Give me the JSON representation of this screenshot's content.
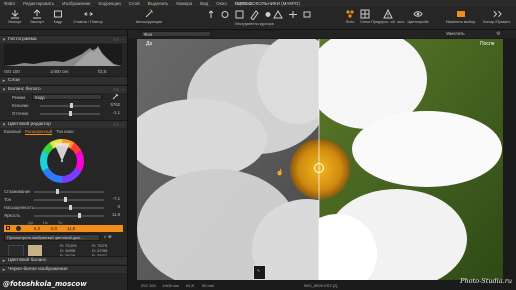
{
  "app": {
    "window_title": "ПИРС СОКОЛЬНИКИ (МАКРО)",
    "menu": [
      "Файл",
      "Редактировать",
      "Изображение",
      "Коррекция",
      "Слой",
      "Выделить",
      "Камера",
      "Вид",
      "Окно",
      "Справка"
    ]
  },
  "toolbar": {
    "left": [
      "Импорт",
      "Экспорт",
      "Кадр",
      "Отмена / Повтор"
    ],
    "auto_adjust": "Автокоррекция",
    "cursor_tools": "Инструменты курсора",
    "right": [
      "Фото",
      "Сетка",
      "Предпрос. об. экст.",
      "Цветопроба",
      "Изменить выбор.",
      "Копир./Примен."
    ]
  },
  "left_panel": {
    "histogram": {
      "title": "Гистограмма",
      "iso": "ISO 100",
      "shutter": "1/400 сек",
      "aperture": "f/2,8"
    },
    "layers": {
      "title": "Слои"
    },
    "white_balance": {
      "title": "Баланс белого",
      "mode_label": "Режим",
      "mode_value": "Кадр",
      "kelvin_label": "Кельвин",
      "kelvin_value": "5762",
      "tint_label": "Оттенок",
      "tint_value": "-1,1"
    },
    "color_editor": {
      "title": "Цветовой редактор",
      "tabs": [
        "Базовый",
        "Расширенный",
        "Тон кожи"
      ],
      "active_tab_index": 1,
      "sliders": [
        {
          "label": "Сглаживание",
          "value": ""
        },
        {
          "label": "Тон",
          "value": "-7,1"
        },
        {
          "label": "Насыщенность",
          "value": "0"
        },
        {
          "label": "Яркость",
          "value": "11,9"
        }
      ],
      "table_headers": [
        "Дн",
        "Нс",
        "Тн"
      ],
      "selected_row": [
        "5,3",
        "0,0",
        "11,9"
      ],
      "selected_row_color": "#f08c1a",
      "preview_button": "Просмотреть выбранный цветовой диа...",
      "readout_left": [
        "R:",
        "G:",
        "B:"
      ],
      "readout_left_values": [
        "75,5%",
        "84/95",
        "26/28"
      ],
      "readout_right": [
        "R:",
        "G:",
        "B:"
      ],
      "readout_right_values": [
        "75/75",
        "67/98",
        "33/37"
      ]
    },
    "color_balance": {
      "title": "Цветовой баланс"
    },
    "bw": {
      "title": "Черно-белое изображение"
    }
  },
  "viewer": {
    "view_dropdown": "Фон",
    "fit_dropdown": "Уместить",
    "before_label": "До",
    "after_label": "После",
    "status": {
      "iso": "ISO 100",
      "shutter": "1/400 сек",
      "aperture": "f/2,8",
      "focal": "50 mm",
      "filename": "IMG_8009.CR2 [2]"
    }
  },
  "overlay": {
    "watermark": "@fotoshkola_moscow",
    "signature": "Photo-Studia.ru"
  },
  "colors": {
    "accent": "#f08c1a",
    "panel": "#262626",
    "header": "#303030"
  }
}
